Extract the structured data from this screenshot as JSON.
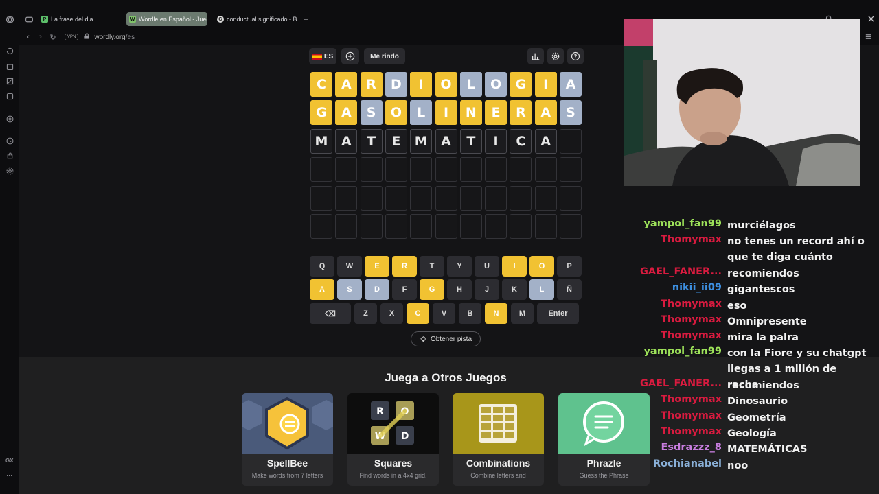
{
  "browser": {
    "tabs": [
      {
        "title": "La frase del dia",
        "favicon": "P",
        "favicon_color": "#5cc06a"
      },
      {
        "title": "Wordle en Español - Juego",
        "favicon": "W",
        "favicon_color": "#7fc26b",
        "active": true
      },
      {
        "title": "conductual significado - B",
        "favicon": "G",
        "favicon_color": "#d9d9d9"
      }
    ],
    "new_tab": "+",
    "vpn": "VPN",
    "url_host": "wordly.org",
    "url_path": "/es",
    "gx_label": "GX",
    "more_label": "⋯"
  },
  "toolbar": {
    "language": "ES",
    "give_up": "Me rindo"
  },
  "board": {
    "rows": [
      {
        "letters": [
          "C",
          "A",
          "R",
          "D",
          "I",
          "O",
          "L",
          "O",
          "G",
          "I",
          "A"
        ],
        "states": [
          "correct",
          "correct",
          "correct",
          "absent",
          "correct",
          "correct",
          "absent",
          "absent",
          "correct",
          "correct",
          "absent"
        ]
      },
      {
        "letters": [
          "G",
          "A",
          "S",
          "O",
          "L",
          "I",
          "N",
          "E",
          "R",
          "A",
          "S"
        ],
        "states": [
          "correct",
          "correct",
          "absent",
          "correct",
          "absent",
          "correct",
          "correct",
          "correct",
          "correct",
          "correct",
          "absent"
        ]
      },
      {
        "letters": [
          "M",
          "A",
          "T",
          "E",
          "M",
          "A",
          "T",
          "I",
          "C",
          "A",
          ""
        ],
        "states": [
          "typed",
          "typed",
          "typed",
          "typed",
          "typed",
          "typed",
          "typed",
          "typed",
          "typed",
          "typed",
          "empty"
        ]
      },
      {
        "letters": [
          "",
          "",
          "",
          "",
          "",
          "",
          "",
          "",
          "",
          "",
          ""
        ],
        "states": [
          "empty",
          "empty",
          "empty",
          "empty",
          "empty",
          "empty",
          "empty",
          "empty",
          "empty",
          "empty",
          "empty"
        ]
      },
      {
        "letters": [
          "",
          "",
          "",
          "",
          "",
          "",
          "",
          "",
          "",
          "",
          ""
        ],
        "states": [
          "empty",
          "empty",
          "empty",
          "empty",
          "empty",
          "empty",
          "empty",
          "empty",
          "empty",
          "empty",
          "empty"
        ]
      },
      {
        "letters": [
          "",
          "",
          "",
          "",
          "",
          "",
          "",
          "",
          "",
          "",
          ""
        ],
        "states": [
          "empty",
          "empty",
          "empty",
          "empty",
          "empty",
          "empty",
          "empty",
          "empty",
          "empty",
          "empty",
          "empty"
        ]
      }
    ]
  },
  "keyboard": {
    "rows": [
      [
        {
          "k": "Q",
          "s": ""
        },
        {
          "k": "W",
          "s": ""
        },
        {
          "k": "E",
          "s": "correct"
        },
        {
          "k": "R",
          "s": "correct"
        },
        {
          "k": "T",
          "s": ""
        },
        {
          "k": "Y",
          "s": ""
        },
        {
          "k": "U",
          "s": ""
        },
        {
          "k": "I",
          "s": "correct"
        },
        {
          "k": "O",
          "s": "correct"
        },
        {
          "k": "P",
          "s": ""
        }
      ],
      [
        {
          "k": "A",
          "s": "correct"
        },
        {
          "k": "S",
          "s": "absent"
        },
        {
          "k": "D",
          "s": "absent"
        },
        {
          "k": "F",
          "s": ""
        },
        {
          "k": "G",
          "s": "correct"
        },
        {
          "k": "H",
          "s": ""
        },
        {
          "k": "J",
          "s": ""
        },
        {
          "k": "K",
          "s": ""
        },
        {
          "k": "L",
          "s": "absent"
        },
        {
          "k": "Ñ",
          "s": ""
        }
      ],
      [
        {
          "k": "⌫",
          "s": "",
          "wide": true
        },
        {
          "k": "Z",
          "s": ""
        },
        {
          "k": "X",
          "s": ""
        },
        {
          "k": "C",
          "s": "correct"
        },
        {
          "k": "V",
          "s": ""
        },
        {
          "k": "B",
          "s": ""
        },
        {
          "k": "N",
          "s": "correct"
        },
        {
          "k": "M",
          "s": ""
        },
        {
          "k": "Enter",
          "s": "",
          "wide": true
        }
      ]
    ]
  },
  "hint_label": "Obtener pista",
  "more_games": {
    "title": "Juega a Otros Juegos",
    "cards": [
      {
        "name": "SpellBee",
        "desc": "Make words from 7 letters",
        "bg": "#4a5a7a"
      },
      {
        "name": "Squares",
        "desc": "Find words in a 4x4 grid.",
        "bg": "#0d0d0d"
      },
      {
        "name": "Combinations",
        "desc": "Combine letters and",
        "bg": "#a8961a"
      },
      {
        "name": "Phrazle",
        "desc": "Guess the Phrase",
        "bg": "#5fc28e"
      }
    ]
  },
  "chat": [
    {
      "user": "yampol_fan99",
      "color": "#9ee35a",
      "text": "murciélagos"
    },
    {
      "user": "Thomymax",
      "color": "#d81b3f",
      "text": "no tenes un record ahí o que te diga cuánto"
    },
    {
      "user": "GAEL_FANER...",
      "color": "#d81b3f",
      "text": "recomiendos"
    },
    {
      "user": "nikii_ii09",
      "color": "#3d8fe0",
      "text": "gigantescos"
    },
    {
      "user": "Thomymax",
      "color": "#d81b3f",
      "text": "eso"
    },
    {
      "user": "Thomymax",
      "color": "#d81b3f",
      "text": "Omnipresente"
    },
    {
      "user": "Thomymax",
      "color": "#d81b3f",
      "text": "mira la palra"
    },
    {
      "user": "yampol_fan99",
      "color": "#9ee35a",
      "text": "con la Fiore y su chatgpt llegas a 1 millón de racha"
    },
    {
      "user": "GAEL_FANER...",
      "color": "#d81b3f",
      "text": "recomiendos"
    },
    {
      "user": "Thomymax",
      "color": "#d81b3f",
      "text": "Dinosaurio"
    },
    {
      "user": "Thomymax",
      "color": "#d81b3f",
      "text": "Geometría"
    },
    {
      "user": "Thomymax",
      "color": "#d81b3f",
      "text": "Geología"
    },
    {
      "user": "Esdrazzz_8",
      "color": "#c77dde",
      "text": "MATEMÁTICAS"
    },
    {
      "user": "Rochianabel",
      "color": "#8ab0d8",
      "text": "noo"
    }
  ]
}
